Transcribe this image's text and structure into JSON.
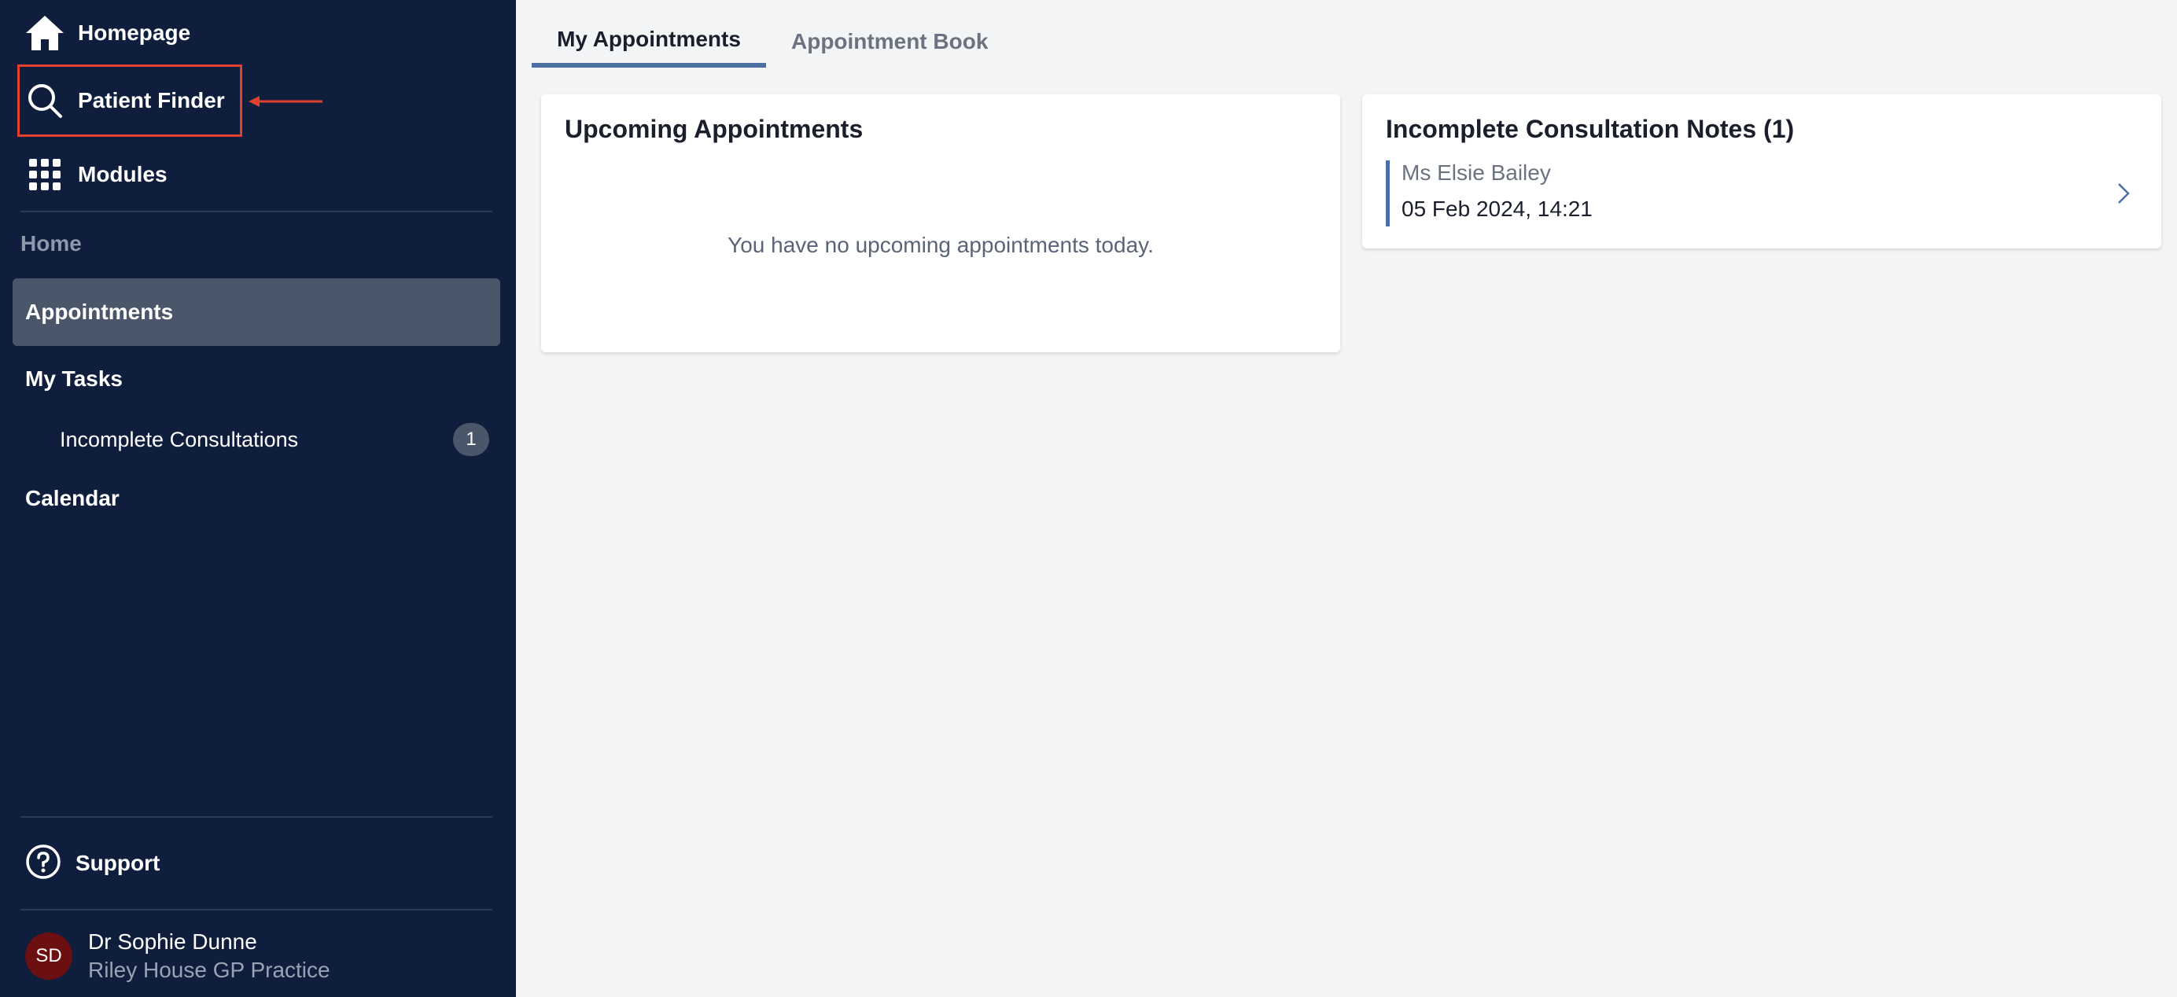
{
  "sidebar": {
    "top_items": {
      "homepage": "Homepage",
      "patient_finder": "Patient Finder",
      "modules": "Modules"
    },
    "section_home": "Home",
    "menu": {
      "appointments": "Appointments",
      "my_tasks": "My Tasks",
      "incomplete_consultations": "Incomplete Consultations",
      "incomplete_count": "1",
      "calendar": "Calendar"
    },
    "support": "Support",
    "user": {
      "initials": "SD",
      "name": "Dr Sophie Dunne",
      "organisation": "Riley House GP Practice"
    },
    "icons": [
      "home-icon",
      "search-icon",
      "grid-icon",
      "help-icon"
    ]
  },
  "tabs": {
    "my_appointments": "My Appointments",
    "appointment_book": "Appointment Book"
  },
  "upcoming": {
    "title": "Upcoming Appointments",
    "empty": "You have no upcoming appointments today."
  },
  "notes": {
    "title": "Incomplete Consultation Notes (1)",
    "items": [
      {
        "patient": "Ms Elsie Bailey",
        "datetime": "05 Feb 2024, 14:21"
      }
    ]
  },
  "colors": {
    "sidebar_bg": "#0f1e3d",
    "active_menu_bg": "#4a5669",
    "accent": "#4b6ea3",
    "annotation_red": "#e2412e",
    "avatar_bg": "#6b0f12"
  }
}
